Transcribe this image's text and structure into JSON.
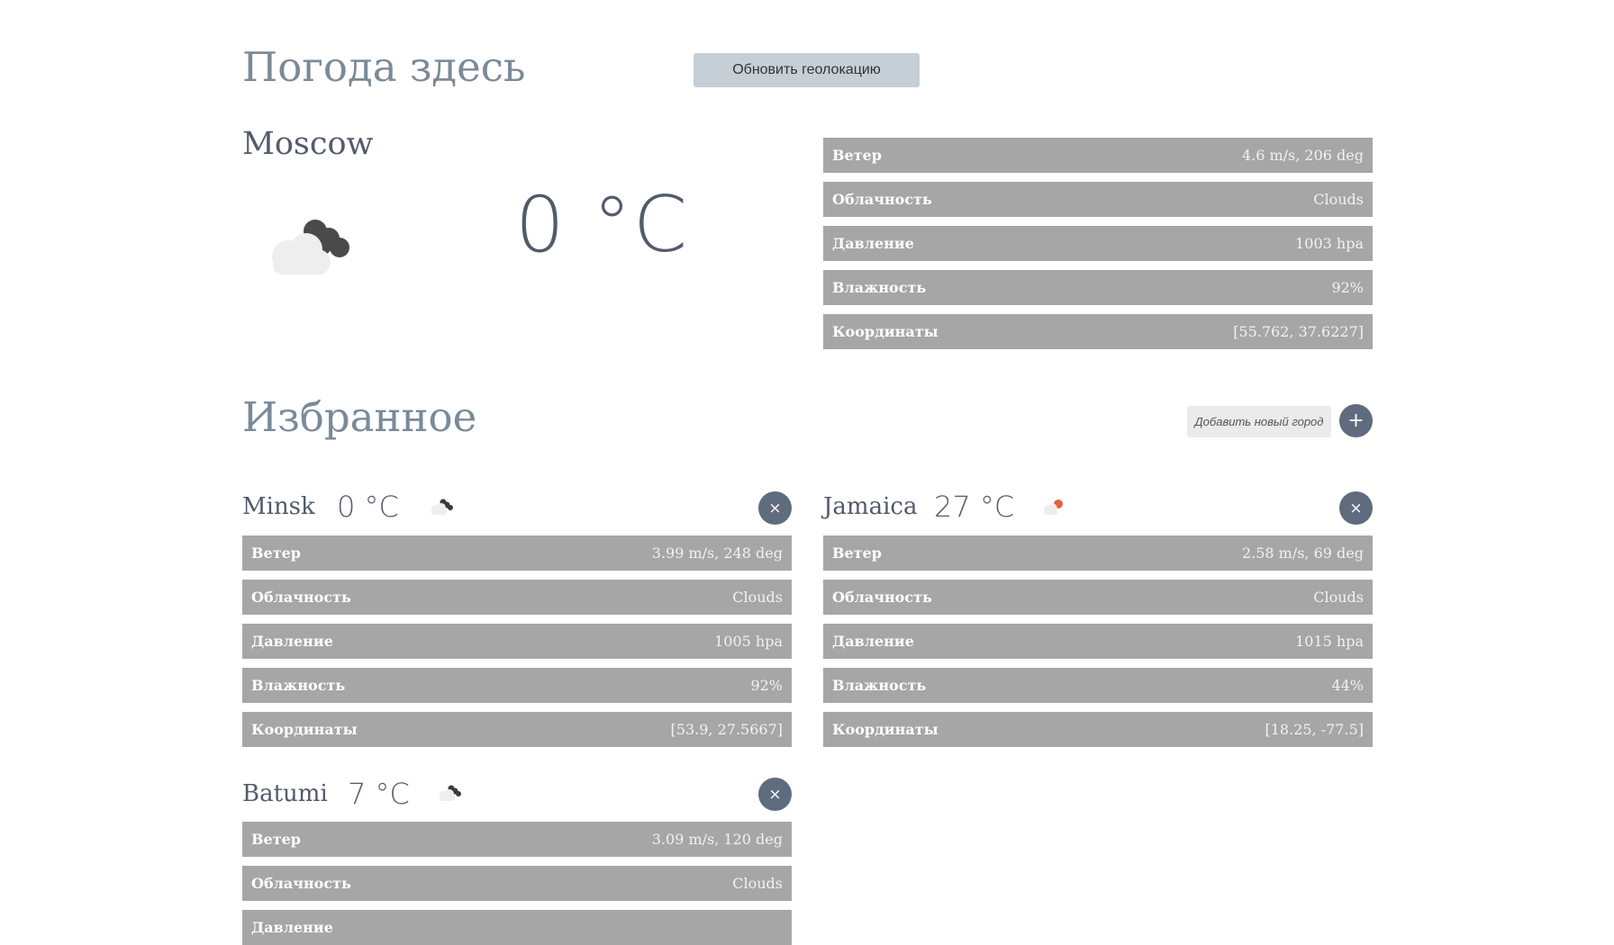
{
  "header": {
    "title": "Погода здесь",
    "geo_button": "Обновить геолокацию"
  },
  "current": {
    "city": "Moscow",
    "temp": "0 °C",
    "icon": "cloud-icon",
    "rows": [
      {
        "label": "Ветер",
        "value": "4.6 m/s, 206 deg"
      },
      {
        "label": "Облачность",
        "value": "Clouds"
      },
      {
        "label": "Давление",
        "value": "1003 hpa"
      },
      {
        "label": "Влажность",
        "value": "92%"
      },
      {
        "label": "Координаты",
        "value": "[55.762, 37.6227]"
      }
    ]
  },
  "favorites": {
    "title": "Избранное",
    "add_button": "Добавить новый город",
    "plus_symbol": "+",
    "close_symbol": "×",
    "cities": [
      {
        "name": "Minsk",
        "temp": "0 °C",
        "icon": "cloud-icon",
        "rows": [
          {
            "label": "Ветер",
            "value": "3.99 m/s, 248 deg"
          },
          {
            "label": "Облачность",
            "value": "Clouds"
          },
          {
            "label": "Давление",
            "value": "1005 hpa"
          },
          {
            "label": "Влажность",
            "value": "92%"
          },
          {
            "label": "Координаты",
            "value": "[53.9, 27.5667]"
          }
        ]
      },
      {
        "name": "Jamaica",
        "temp": "27 °C",
        "icon": "sun-cloud-icon",
        "rows": [
          {
            "label": "Ветер",
            "value": "2.58 m/s, 69 deg"
          },
          {
            "label": "Облачность",
            "value": "Clouds"
          },
          {
            "label": "Давление",
            "value": "1015 hpa"
          },
          {
            "label": "Влажность",
            "value": "44%"
          },
          {
            "label": "Координаты",
            "value": "[18.25, -77.5]"
          }
        ]
      },
      {
        "name": "Batumi",
        "temp": "7 °C",
        "icon": "cloud-icon",
        "rows": [
          {
            "label": "Ветер",
            "value": "3.09 m/s, 120 deg"
          },
          {
            "label": "Облачность",
            "value": "Clouds"
          },
          {
            "label": "Давление",
            "value": ""
          }
        ]
      }
    ]
  },
  "colors": {
    "heading": "#7a8a99",
    "row_bg": "#a6a6a6",
    "round_button": "#5f6b7f",
    "sun": "#e8613c"
  }
}
